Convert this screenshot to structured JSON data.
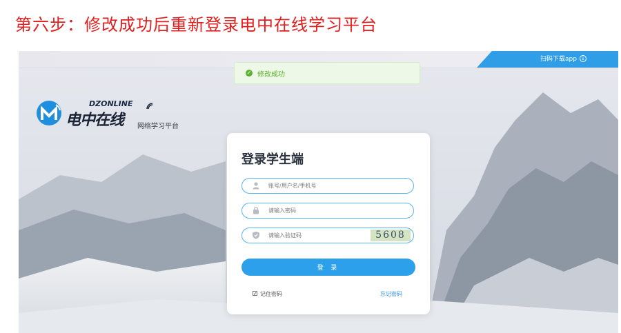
{
  "heading": "第六步：修改成功后重新登录电中在线学习平台",
  "topbar": {
    "download_label": "扫码下载app",
    "download_icon": "circle-arrow-down-icon"
  },
  "toast": {
    "message": "修改成功",
    "icon": "check-circle-icon",
    "color": "#5cb130"
  },
  "logo": {
    "en": "DZONLINE",
    "cn": "电中在线",
    "subtitle": "网络学习平台"
  },
  "login": {
    "title": "登录学生端",
    "account_placeholder": "账号/用户名/手机号",
    "password_placeholder": "请输入密码",
    "captcha_placeholder": "请输入验证码",
    "captcha_code": "5608",
    "submit_label": "登 录",
    "remember_label": "记住密码",
    "remember_checked": true,
    "forgot_label": "忘记密码"
  },
  "colors": {
    "accent": "#2ca0ea",
    "heading": "#e02020",
    "field_border": "#5ab4ee"
  }
}
